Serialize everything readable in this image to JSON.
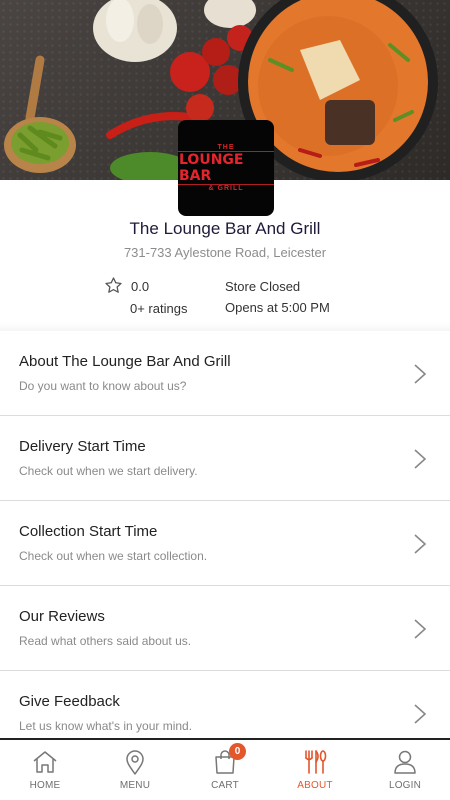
{
  "store": {
    "name": "The Lounge Bar And Grill",
    "address": "731-733 Aylestone Road, Leicester",
    "rating": "0.0",
    "ratings_count": "0+ ratings",
    "status": "Store Closed",
    "opens_at": "Opens at 5:00 PM"
  },
  "logo": {
    "line_top": "THE",
    "line_main": "LOUNGE BAR",
    "line_bottom": "& GRILL"
  },
  "menu": {
    "items": [
      {
        "title": "About The Lounge Bar And Grill",
        "subtitle": "Do you want to know about us?"
      },
      {
        "title": "Delivery Start Time",
        "subtitle": "Check out when we start delivery."
      },
      {
        "title": "Collection Start Time",
        "subtitle": "Check out when we start collection."
      },
      {
        "title": "Our Reviews",
        "subtitle": "Read what others said about us."
      },
      {
        "title": "Give Feedback",
        "subtitle": "Let us know what's in your mind."
      }
    ]
  },
  "nav": {
    "items": [
      {
        "label": "HOME",
        "icon": "home-icon"
      },
      {
        "label": "MENU",
        "icon": "location-pin-icon"
      },
      {
        "label": "CART",
        "icon": "shopping-bag-icon",
        "badge": "0"
      },
      {
        "label": "ABOUT",
        "icon": "cutlery-icon",
        "active": true
      },
      {
        "label": "LOGIN",
        "icon": "user-icon"
      }
    ]
  },
  "colors": {
    "accent": "#e3572b",
    "title_text": "#1d1b3a",
    "logo_red": "#e3262d"
  }
}
